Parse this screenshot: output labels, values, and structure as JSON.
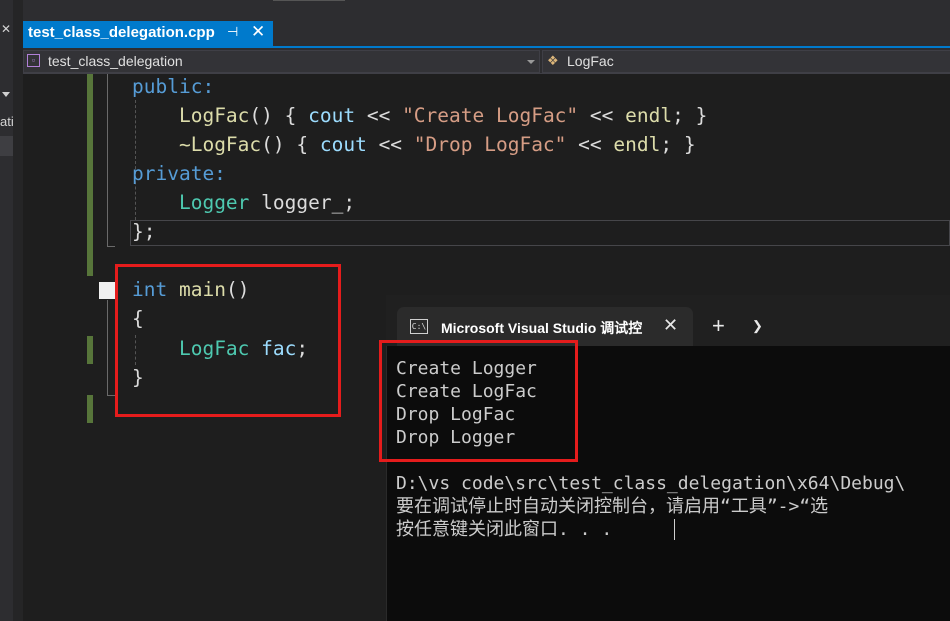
{
  "tabs": [
    {
      "label": "test_class_delegation.cpp",
      "pin_icon": "pin-icon",
      "close_icon": "close-icon",
      "active": true
    }
  ],
  "navbar": {
    "scope": "test_class_delegation",
    "member": "LogFac"
  },
  "code_lines": [
    "public:",
    "    LogFac() { cout << \"Create LogFac\" << endl; }",
    "    ~LogFac() { cout << \"Drop LogFac\" << endl; }",
    "private:",
    "    Logger logger_;",
    "};",
    "int main()",
    "{",
    "    LogFac fac;",
    "}"
  ],
  "console": {
    "title": "Microsoft Visual Studio 调试控",
    "output": [
      "Create Logger",
      "Create LogFac",
      "Drop LogFac",
      "Drop Logger"
    ],
    "path_line": "D:\\vs code\\src\\test_class_delegation\\x64\\Debug\\",
    "hint_line": "要在调试停止时自动关闭控制台，请启用“工具”->“选",
    "press_line": "按任意键关闭此窗口. . ."
  },
  "colors": {
    "accent": "#007acc",
    "highlight_box": "#e51c1c",
    "keyword": "#569cd6",
    "type": "#4ec9b0",
    "string": "#d69d85",
    "function": "#dcdcaa"
  }
}
